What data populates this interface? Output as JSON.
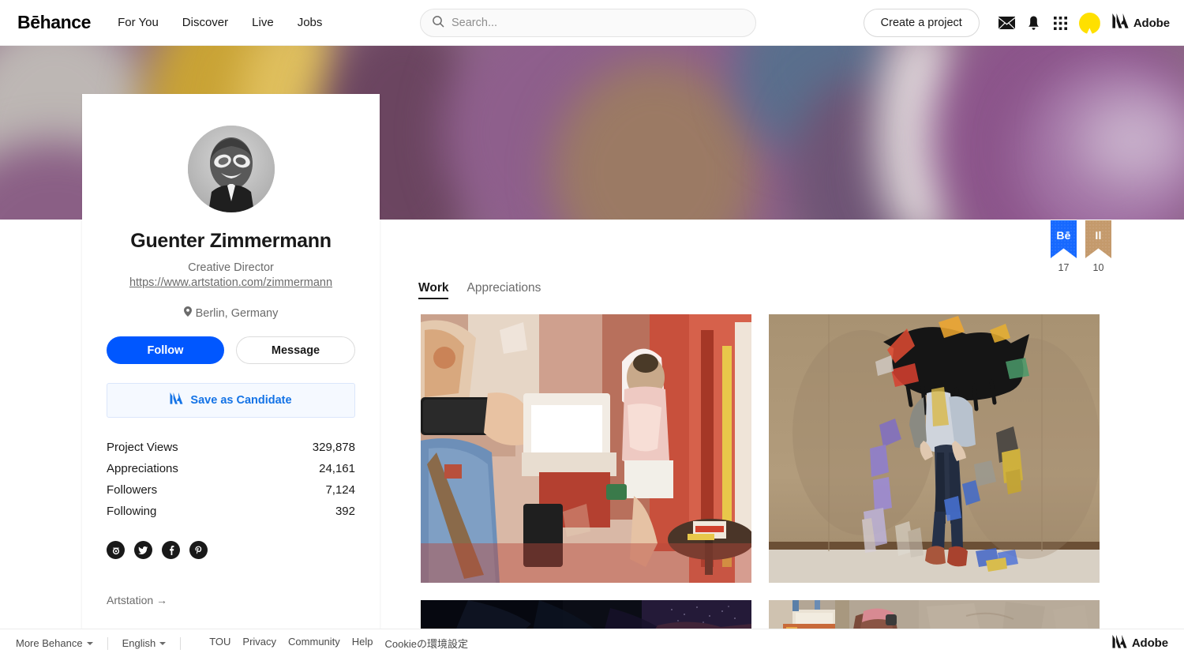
{
  "header": {
    "brand": "Bēhance",
    "nav": [
      {
        "label": "For You",
        "name": "nav-for-you"
      },
      {
        "label": "Discover",
        "name": "nav-discover"
      },
      {
        "label": "Live",
        "name": "nav-live"
      },
      {
        "label": "Jobs",
        "name": "nav-jobs"
      }
    ],
    "search": {
      "placeholder": "Search...",
      "value": "",
      "icon": "search-icon"
    },
    "create_button": "Create a project",
    "icons": [
      "mail-icon",
      "bell-icon",
      "apps-grid-icon"
    ],
    "user_avatar": {
      "name": "user-avatar",
      "color": "#FFE000"
    },
    "adobe": "Adobe"
  },
  "cover": {
    "name": "profile-cover-image",
    "description": "Blurred close-up photograph of purple plums with a golden yellow object at left",
    "colors": [
      "#8b5f86",
      "#c8a63a",
      "#6b4a63",
      "#a06f9e"
    ]
  },
  "profile": {
    "avatar_name": "profile-avatar",
    "name": "Guenter Zimmermann",
    "title": "Creative Director",
    "url": "https://www.artstation.com/zimmermann",
    "location": "Berlin, Germany",
    "location_icon": "location-pin-icon",
    "follow_button": "Follow",
    "message_button": "Message",
    "save_candidate": {
      "label": "Save as Candidate",
      "icon": "adobe-logo-icon"
    },
    "stats": [
      {
        "label": "Project Views",
        "value": "329,878"
      },
      {
        "label": "Appreciations",
        "value": "24,161"
      },
      {
        "label": "Followers",
        "value": "7,124"
      },
      {
        "label": "Following",
        "value": "392"
      }
    ],
    "socials": [
      {
        "name": "instagram-icon",
        "glyph": "◎"
      },
      {
        "name": "twitter-icon",
        "glyph": "🐦"
      },
      {
        "name": "facebook-icon",
        "glyph": "f"
      },
      {
        "name": "pinterest-icon",
        "glyph": "P"
      }
    ],
    "external_link": "Artstation →",
    "accent_color": "#0057ff"
  },
  "main": {
    "ribbons": [
      {
        "name": "behance-ribbon-badge",
        "glyph": "Bē",
        "count": "17",
        "color": "#1769ff"
      },
      {
        "name": "illustrator-ribbon-badge",
        "glyph": "Il",
        "count": "10",
        "color": "#c49a6c"
      }
    ],
    "tabs": [
      {
        "label": "Work",
        "active": true
      },
      {
        "label": "Appreciations",
        "active": false
      }
    ],
    "projects": [
      {
        "name": "project-card-1",
        "description": "Painterly illustration of a fast-food restaurant interior with two figures"
      },
      {
        "name": "project-card-2",
        "description": "Abstract figure with dark splattered head on tan background"
      },
      {
        "name": "project-card-3",
        "description": "Dark navy night scene illustration"
      },
      {
        "name": "project-card-4",
        "description": "Warm beige interior with a figure in pink"
      }
    ]
  },
  "footer": {
    "more_behance": "More Behance",
    "language": "English",
    "links": [
      "TOU",
      "Privacy",
      "Community",
      "Help",
      "Cookieの環境設定"
    ],
    "adobe": "Adobe"
  }
}
